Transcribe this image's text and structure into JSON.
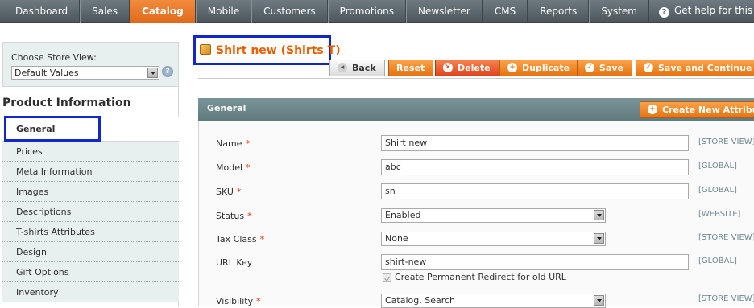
{
  "nav": {
    "items": [
      "Dashboard",
      "Sales",
      "Catalog",
      "Mobile",
      "Customers",
      "Promotions",
      "Newsletter",
      "CMS",
      "Reports",
      "System"
    ],
    "active": "Catalog",
    "help_text": "Get help for this pa"
  },
  "store_switcher": {
    "label": "Choose Store View:",
    "value": "Default Values"
  },
  "sidebar": {
    "title": "Product Information",
    "tabs": [
      "General",
      "Prices",
      "Meta Information",
      "Images",
      "Descriptions",
      "T-shirts Attributes",
      "Design",
      "Gift Options",
      "Inventory"
    ]
  },
  "header": {
    "title": "Shirt new (Shirts T)"
  },
  "buttons": {
    "back": "Back",
    "reset": "Reset",
    "delete": "Delete",
    "duplicate": "Duplicate",
    "save": "Save",
    "save_continue": "Save and Continue Ed"
  },
  "section": {
    "title": "General",
    "create_attribute": "Create New Attribute"
  },
  "form": {
    "name": {
      "label": "Name",
      "value": "Shirt new",
      "scope": "[STORE VIEW]"
    },
    "model": {
      "label": "Model",
      "value": "abc",
      "scope": "[GLOBAL]"
    },
    "sku": {
      "label": "SKU",
      "value": "sn",
      "scope": "[GLOBAL]"
    },
    "status": {
      "label": "Status",
      "value": "Enabled",
      "scope": "[WEBSITE]"
    },
    "tax_class": {
      "label": "Tax Class",
      "value": "None",
      "scope": "[STORE VIEW]"
    },
    "url_key": {
      "label": "URL Key",
      "value": "shirt-new",
      "scope": "[GLOBAL]",
      "redirect_label": "Create Permanent Redirect for old URL"
    },
    "visibility": {
      "label": "Visibility",
      "value": "Catalog, Search",
      "scope": "[STORE VIEW]"
    },
    "required_marker": "*"
  },
  "colors": {
    "accent": "#eb5e00",
    "highlight": "#1227c8",
    "nav_bg": "#5d6a70",
    "section_head": "#6b8689"
  }
}
